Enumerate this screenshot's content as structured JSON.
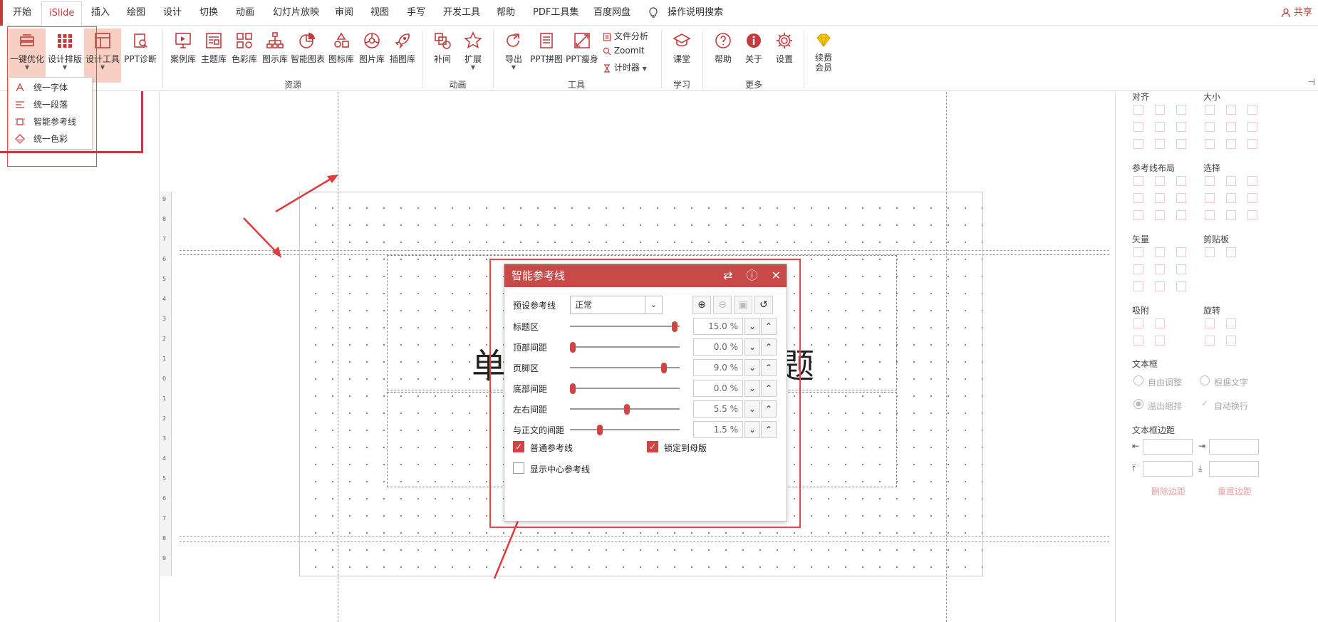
{
  "menu": {
    "tabs": [
      "开始",
      "iSlide",
      "插入",
      "绘图",
      "设计",
      "切换",
      "动画",
      "幻灯片放映",
      "审阅",
      "视图",
      "手写",
      "开发工具",
      "帮助",
      "PDF工具集",
      "百度网盘"
    ],
    "search": "操作说明搜索",
    "share": "共享"
  },
  "ribbon": {
    "buttons": [
      {
        "label": "一键优化"
      },
      {
        "label": "设计排版"
      },
      {
        "label": "设计工具"
      },
      {
        "label": "PPT诊断"
      },
      {
        "label": "案例库"
      },
      {
        "label": "主题库"
      },
      {
        "label": "色彩库"
      },
      {
        "label": "图示库"
      },
      {
        "label": "智能图表"
      },
      {
        "label": "图标库"
      },
      {
        "label": "图片库"
      },
      {
        "label": "插图库"
      },
      {
        "label": "补间"
      },
      {
        "label": "扩展"
      },
      {
        "label": "导出"
      },
      {
        "label": "PPT拼图"
      },
      {
        "label": "PPT瘦身"
      },
      {
        "label": "课堂"
      },
      {
        "label": "帮助"
      },
      {
        "label": "关于"
      },
      {
        "label": "设置"
      },
      {
        "label": "续费\n会员"
      }
    ],
    "small_items": [
      "文件分析",
      "ZoomIt",
      "计时器"
    ],
    "groups": [
      "资源",
      "动画",
      "工具",
      "学习",
      "更多"
    ]
  },
  "dropdown": {
    "items": [
      "统一字体",
      "统一段落",
      "智能参考线",
      "统一色彩"
    ]
  },
  "slide": {
    "title_left": "单",
    "title_right": "题",
    "ruler_ticks": [
      "9",
      "8",
      "7",
      "6",
      "5",
      "4",
      "3",
      "2",
      "1",
      "0",
      "1",
      "2",
      "3",
      "4",
      "5",
      "6",
      "7",
      "8",
      "9"
    ]
  },
  "dialog": {
    "title": "智能参考线",
    "preset_label": "预设参考线",
    "preset_value": "正常",
    "rows": [
      {
        "label": "标题区",
        "value": "15.0 %",
        "knob": 0.98
      },
      {
        "label": "顶部间距",
        "value": "0.0 %",
        "knob": 0.0
      },
      {
        "label": "页脚区",
        "value": "9.0 %",
        "knob": 0.88
      },
      {
        "label": "底部间距",
        "value": "0.0 %",
        "knob": 0.0
      },
      {
        "label": "左右间距",
        "value": "5.5 %",
        "knob": 0.52
      },
      {
        "label": "与正文的间距",
        "value": "1.5 %",
        "knob": 0.26
      }
    ],
    "check_normal": "普通参考线",
    "check_lock": "锁定到母版",
    "check_center": "显示中心参考线"
  },
  "rightpanel": {
    "headers": [
      "对齐",
      "大小",
      "参考线布局",
      "选择",
      "矢量",
      "剪贴板",
      "吸附",
      "旋转",
      "文本框",
      "文本框边距"
    ],
    "textbox_options": [
      "自由调整",
      "根据文字",
      "溢出缩排",
      "自动换行"
    ],
    "margin_actions": [
      "删除边距",
      "重置边距"
    ]
  },
  "colors": {
    "accent": "#c43b3b",
    "dialog_header": "#c84a48",
    "highlight": "#f7cfc3"
  }
}
